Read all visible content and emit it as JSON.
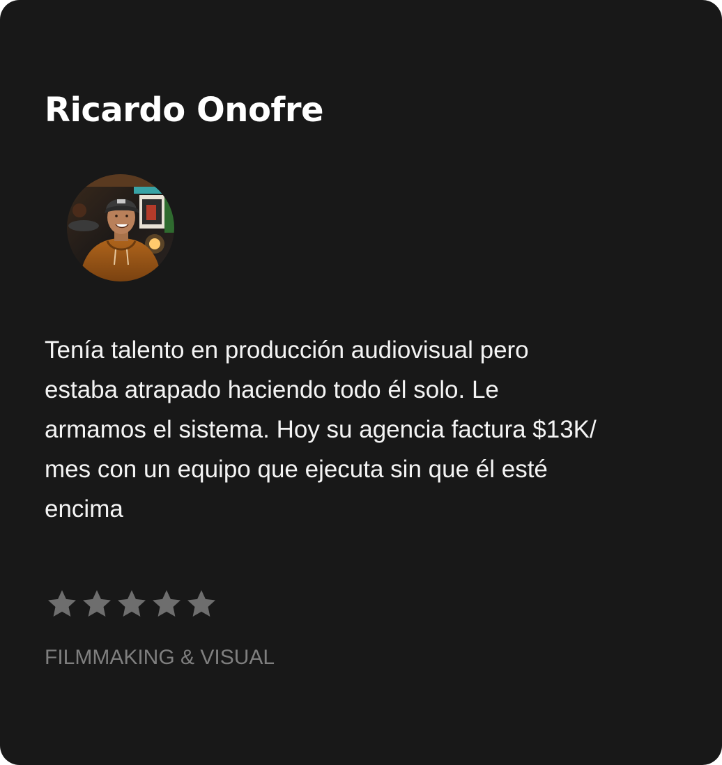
{
  "testimonial": {
    "name": "Ricardo Onofre",
    "avatar_alt": "Ricardo Onofre",
    "quote": "Tenía talento en producción audiovisual pero\nestaba atrapado haciendo todo él solo. Le\narmamos el  sistema. Hoy su agencia factura $13K/\nmes con un equipo que ejecuta sin que él esté\nencima",
    "rating": 5,
    "rating_max": 5,
    "category": "FILMMAKING & VISUAL"
  },
  "colors": {
    "card_background": "#181818",
    "name_text": "#ffffff",
    "quote_text": "#f4f4f4",
    "star": "#6e6e6e",
    "category_text": "#7f7f7f"
  },
  "icons": {
    "rating_star": "star-icon"
  }
}
